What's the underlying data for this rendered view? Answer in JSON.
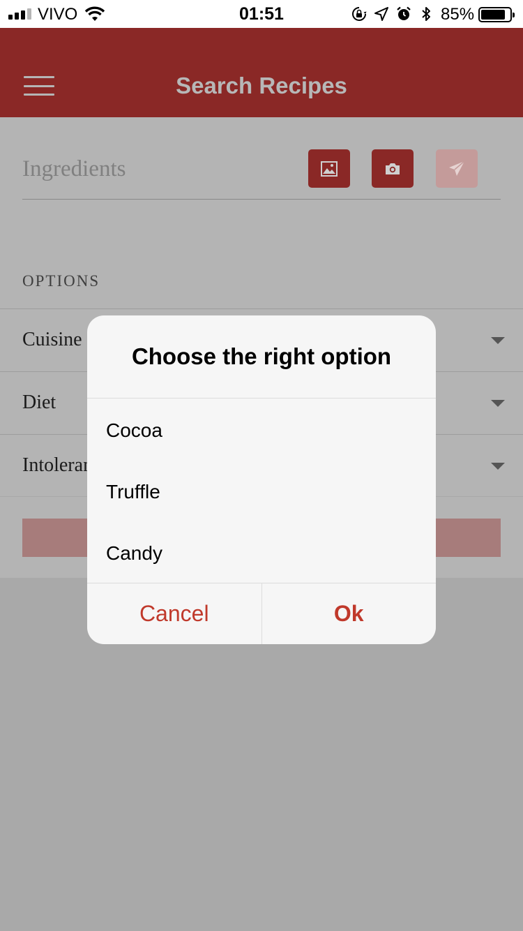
{
  "status_bar": {
    "carrier": "VIVO",
    "time": "01:51",
    "battery_percent": "85%",
    "battery_level": 0.85,
    "signal_bars_active": 3,
    "signal_bars_total": 4,
    "icons": [
      "orientation-lock-icon",
      "location-arrow-icon",
      "alarm-icon",
      "bluetooth-icon"
    ]
  },
  "header": {
    "title": "Search Recipes",
    "menu_icon": "hamburger-menu-icon",
    "color": "#8a2826"
  },
  "search": {
    "ingredients_placeholder": "Ingredients",
    "buttons": [
      {
        "icon": "image-gallery-icon"
      },
      {
        "icon": "camera-icon"
      },
      {
        "icon": "send-paper-plane-icon"
      }
    ]
  },
  "options": {
    "heading": "OPTIONS",
    "rows": [
      {
        "label": "Cuisine"
      },
      {
        "label": "Diet"
      },
      {
        "label": "Intoleran"
      }
    ]
  },
  "dialog": {
    "title": "Choose the right option",
    "choices": [
      "Cocoa",
      "Truffle",
      "Candy"
    ],
    "cancel_label": "Cancel",
    "ok_label": "Ok",
    "accent": "#c0392b"
  }
}
